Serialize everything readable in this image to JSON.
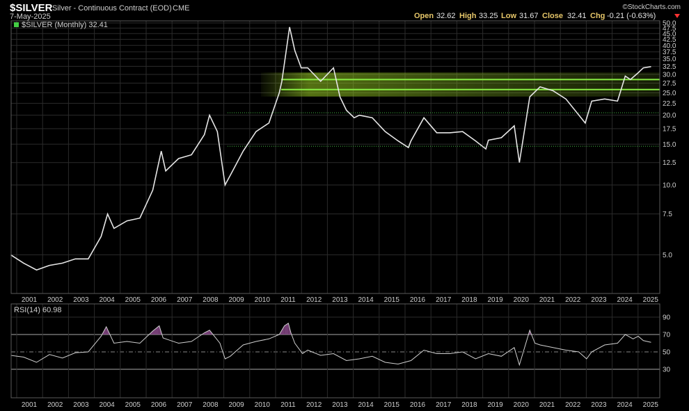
{
  "header": {
    "symbol": "$SILVER",
    "description": "Silver - Continuous Contract (EOD)",
    "exchange": "CME",
    "date": "7-May-2025",
    "brand": "©StockCharts.com",
    "open_label": "Open",
    "open": "32.62",
    "high_label": "High",
    "high": "33.25",
    "low_label": "Low",
    "low": "31.67",
    "close_label": "Close",
    "close": "32.41",
    "chg_label": "Chg",
    "chg": "-0.21 (-0.63%)"
  },
  "colors": {
    "background": "#000000",
    "price": "#e6e6e6",
    "support_band": "#88ee44",
    "support_dotted": "#44bb44",
    "rsi_line": "#d0d0d0",
    "rsi_overbought_fill": "#8a4a8a",
    "down_arrow": "#ff3333"
  },
  "chart_data": [
    {
      "type": "line",
      "legend": "$SILVER (Monthly) 32.41",
      "scale": "log",
      "ylim": [
        3.5,
        50
      ],
      "y_ticks": [
        "50.0",
        "47.5",
        "45.0",
        "42.5",
        "40.0",
        "37.5",
        "35.0",
        "32.5",
        "30.0",
        "27.5",
        "25.0",
        "22.5",
        "20.0",
        "17.5",
        "15.0",
        "12.5",
        "10.0",
        "7.5",
        "5.0"
      ],
      "x_ticks": [
        "2001",
        "2002",
        "2003",
        "2004",
        "2005",
        "2006",
        "2007",
        "2008",
        "2009",
        "2010",
        "2011",
        "2012",
        "2013",
        "2014",
        "2015",
        "2016",
        "2017",
        "2018",
        "2019",
        "2020",
        "2021",
        "2022",
        "2023",
        "2024",
        "2025"
      ],
      "horizontal_levels": [
        {
          "value": 28.5,
          "style": "solid"
        },
        {
          "value": 25.8,
          "style": "solid"
        },
        {
          "value": 20.5,
          "style": "dotted"
        },
        {
          "value": 14.7,
          "style": "dotted"
        }
      ],
      "series": [
        {
          "x": [
            2000.5,
            2001.0,
            2001.5,
            2002.0,
            2002.5,
            2003.0,
            2003.5,
            2004.0,
            2004.25,
            2004.5,
            2005.0,
            2005.5,
            2006.0,
            2006.33,
            2006.5,
            2007.0,
            2007.5,
            2008.0,
            2008.2,
            2008.5,
            2008.8,
            2009.0,
            2009.5,
            2010.0,
            2010.5,
            2010.9,
            2011.0,
            2011.3,
            2011.5,
            2011.75,
            2012.0,
            2012.5,
            2013.0,
            2013.25,
            2013.5,
            2013.8,
            2014.0,
            2014.5,
            2015.0,
            2015.5,
            2015.9,
            2016.0,
            2016.5,
            2017.0,
            2017.5,
            2018.0,
            2018.5,
            2018.9,
            2019.0,
            2019.5,
            2020.0,
            2020.2,
            2020.6,
            2021.0,
            2021.5,
            2022.0,
            2022.75,
            2023.0,
            2023.5,
            2024.0,
            2024.3,
            2024.5,
            2024.8,
            2025.0,
            2025.3
          ],
          "values": [
            5.0,
            4.6,
            4.3,
            4.5,
            4.6,
            4.8,
            4.8,
            6.0,
            7.5,
            6.5,
            7.0,
            7.2,
            9.5,
            14.0,
            11.5,
            13.0,
            13.5,
            16.5,
            20.0,
            17.0,
            10.0,
            11.0,
            14.0,
            17.0,
            18.5,
            25.0,
            28.0,
            48.0,
            38.0,
            32.0,
            32.0,
            28.0,
            32.0,
            24.0,
            21.0,
            19.5,
            20.0,
            19.5,
            17.0,
            15.5,
            14.5,
            15.5,
            19.5,
            16.8,
            16.8,
            17.0,
            15.5,
            14.3,
            15.6,
            16.0,
            18.0,
            12.5,
            24.0,
            26.5,
            25.5,
            23.5,
            18.5,
            23.0,
            23.5,
            23.0,
            29.5,
            28.5,
            30.5,
            32.0,
            32.41
          ]
        }
      ]
    },
    {
      "type": "line",
      "legend": "RSI(14) 60.98",
      "ylim": [
        10,
        100
      ],
      "y_ticks": [
        "90",
        "70",
        "50",
        "30"
      ],
      "reference_lines": [
        70,
        50,
        30
      ],
      "x_ticks": [
        "2001",
        "2002",
        "2003",
        "2004",
        "2005",
        "2006",
        "2007",
        "2008",
        "2009",
        "2010",
        "2011",
        "2012",
        "2013",
        "2014",
        "2015",
        "2016",
        "2017",
        "2018",
        "2019",
        "2020",
        "2021",
        "2022",
        "2023",
        "2024",
        "2025"
      ],
      "series": [
        {
          "x": [
            2000.5,
            2001.0,
            2001.5,
            2002.0,
            2002.5,
            2003.0,
            2003.5,
            2004.0,
            2004.2,
            2004.5,
            2005.0,
            2005.5,
            2006.0,
            2006.25,
            2006.4,
            2006.7,
            2007.0,
            2007.5,
            2008.0,
            2008.2,
            2008.6,
            2008.8,
            2009.0,
            2009.5,
            2010.0,
            2010.5,
            2010.9,
            2011.1,
            2011.25,
            2011.35,
            2011.5,
            2011.8,
            2012.0,
            2012.5,
            2013.0,
            2013.5,
            2014.0,
            2014.5,
            2015.0,
            2015.5,
            2016.0,
            2016.5,
            2017.0,
            2017.5,
            2018.0,
            2018.5,
            2019.0,
            2019.5,
            2020.0,
            2020.2,
            2020.6,
            2020.8,
            2021.0,
            2021.5,
            2022.0,
            2022.5,
            2022.8,
            2023.0,
            2023.5,
            2024.0,
            2024.3,
            2024.6,
            2024.8,
            2025.0,
            2025.3
          ],
          "values": [
            46,
            44,
            38,
            47,
            43,
            49,
            50,
            68,
            79,
            60,
            62,
            60,
            74,
            80,
            66,
            63,
            60,
            62,
            72,
            75,
            60,
            42,
            45,
            58,
            62,
            65,
            70,
            80,
            83,
            72,
            60,
            48,
            52,
            46,
            48,
            40,
            42,
            45,
            38,
            36,
            40,
            52,
            48,
            48,
            50,
            42,
            48,
            45,
            55,
            35,
            75,
            60,
            58,
            55,
            52,
            50,
            42,
            50,
            58,
            60,
            70,
            65,
            68,
            63,
            61
          ]
        }
      ]
    }
  ]
}
